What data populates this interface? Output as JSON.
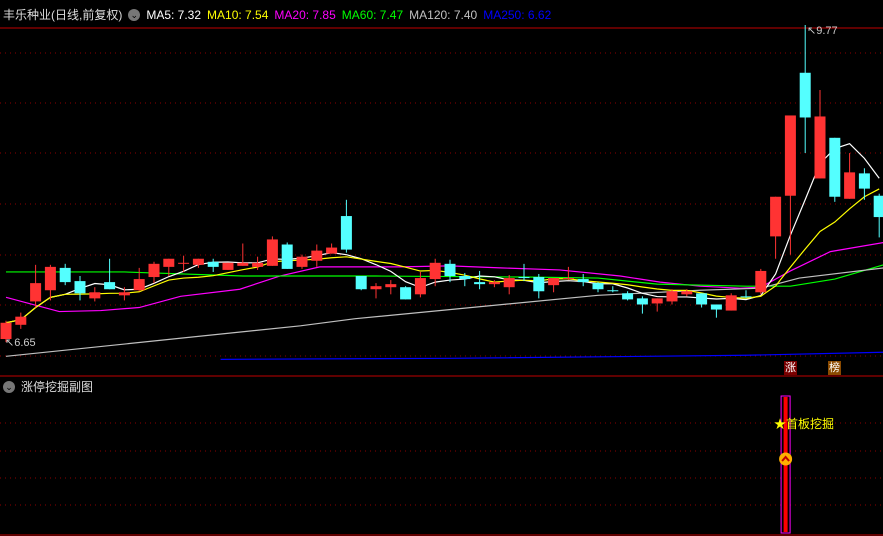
{
  "header": {
    "stock_title": "丰乐种业(日线,前复权)",
    "ma_values": [
      {
        "label": "MA5: 7.32",
        "color": "#ffffff"
      },
      {
        "label": "MA10: 7.54",
        "color": "#ffff00"
      },
      {
        "label": "MA20: 7.85",
        "color": "#ff00ff"
      },
      {
        "label": "MA60: 7.47",
        "color": "#00ff00"
      },
      {
        "label": "MA120: 7.40",
        "color": "#c0c0c0"
      },
      {
        "label": "MA250: 6.62",
        "color": "#0000ff"
      }
    ]
  },
  "sub_panel": {
    "title": "涨停挖掘副图",
    "signal_label": "首板挖掘",
    "tags": [
      "涨",
      "榜"
    ]
  },
  "colors": {
    "up": "#ff3333",
    "down": "#54ffff",
    "grid": "#8b0000",
    "border": "#c00000"
  },
  "chart_data": {
    "type": "candlestick",
    "title": "丰乐种业(日线,前复权)",
    "ylim": [
      6.65,
      9.77
    ],
    "annotations": {
      "high_label": "9.77",
      "low_label": "6.65"
    },
    "ohlc": [
      [
        6.68,
        6.86,
        6.65,
        6.84
      ],
      [
        6.82,
        6.94,
        6.78,
        6.9
      ],
      [
        7.05,
        7.41,
        6.99,
        7.23
      ],
      [
        7.16,
        7.41,
        7.06,
        7.39
      ],
      [
        7.38,
        7.42,
        7.21,
        7.24
      ],
      [
        7.25,
        7.3,
        7.06,
        7.13
      ],
      [
        7.08,
        7.19,
        7.05,
        7.14
      ],
      [
        7.24,
        7.47,
        7.17,
        7.17
      ],
      [
        7.11,
        7.19,
        7.06,
        7.14
      ],
      [
        7.16,
        7.38,
        7.15,
        7.27
      ],
      [
        7.29,
        7.44,
        7.23,
        7.42
      ],
      [
        7.39,
        7.47,
        7.3,
        7.47
      ],
      [
        7.43,
        7.5,
        7.34,
        7.43
      ],
      [
        7.41,
        7.47,
        7.38,
        7.47
      ],
      [
        7.44,
        7.47,
        7.34,
        7.39
      ],
      [
        7.36,
        7.43,
        7.36,
        7.43
      ],
      [
        7.4,
        7.62,
        7.4,
        7.43
      ],
      [
        7.39,
        7.49,
        7.36,
        7.43
      ],
      [
        7.4,
        7.69,
        7.4,
        7.66
      ],
      [
        7.61,
        7.63,
        7.37,
        7.37
      ],
      [
        7.39,
        7.51,
        7.37,
        7.49
      ],
      [
        7.45,
        7.61,
        7.39,
        7.55
      ],
      [
        7.52,
        7.62,
        7.52,
        7.58
      ],
      [
        7.89,
        8.05,
        7.53,
        7.56
      ],
      [
        7.3,
        7.3,
        7.16,
        7.17
      ],
      [
        7.17,
        7.23,
        7.08,
        7.2
      ],
      [
        7.19,
        7.26,
        7.12,
        7.22
      ],
      [
        7.19,
        7.2,
        7.07,
        7.07
      ],
      [
        7.12,
        7.34,
        7.09,
        7.28
      ],
      [
        7.27,
        7.47,
        7.2,
        7.43
      ],
      [
        7.42,
        7.46,
        7.24,
        7.3
      ],
      [
        7.3,
        7.33,
        7.2,
        7.27
      ],
      [
        7.24,
        7.35,
        7.17,
        7.22
      ],
      [
        7.22,
        7.26,
        7.19,
        7.24
      ],
      [
        7.19,
        7.31,
        7.12,
        7.28
      ],
      [
        7.29,
        7.42,
        7.25,
        7.28
      ],
      [
        7.29,
        7.32,
        7.08,
        7.15
      ],
      [
        7.21,
        7.28,
        7.14,
        7.28
      ],
      [
        7.28,
        7.39,
        7.26,
        7.28
      ],
      [
        7.27,
        7.32,
        7.2,
        7.24
      ],
      [
        7.23,
        7.24,
        7.14,
        7.17
      ],
      [
        7.16,
        7.2,
        7.14,
        7.15
      ],
      [
        7.13,
        7.15,
        7.06,
        7.07
      ],
      [
        7.08,
        7.1,
        6.93,
        7.02
      ],
      [
        7.03,
        7.08,
        6.95,
        7.08
      ],
      [
        7.05,
        7.17,
        7.02,
        7.15
      ],
      [
        7.12,
        7.17,
        7.1,
        7.15
      ],
      [
        7.13,
        7.13,
        6.99,
        7.02
      ],
      [
        7.02,
        7.02,
        6.89,
        6.97
      ],
      [
        6.96,
        7.13,
        6.96,
        7.11
      ],
      [
        7.1,
        7.16,
        7.08,
        7.09
      ],
      [
        7.14,
        7.37,
        7.12,
        7.35
      ],
      [
        7.69,
        8.08,
        7.47,
        8.08
      ],
      [
        8.09,
        8.88,
        7.51,
        8.88
      ],
      [
        9.3,
        9.77,
        8.51,
        8.86
      ],
      [
        8.26,
        9.13,
        8.26,
        8.87
      ],
      [
        8.66,
        8.66,
        8.03,
        8.08
      ],
      [
        8.06,
        8.51,
        8.06,
        8.32
      ],
      [
        8.31,
        8.36,
        8.05,
        8.16
      ],
      [
        8.09,
        8.11,
        7.68,
        7.88
      ]
    ],
    "ma_computed": [
      {
        "name": "MA5",
        "period": 5,
        "color": "#ffffff"
      },
      {
        "name": "MA10",
        "period": 10,
        "color": "#ffff00"
      }
    ],
    "ma_points": [
      {
        "name": "MA20",
        "color": "#ff00ff",
        "points": [
          [
            0,
            7.09
          ],
          [
            3.6,
            6.95
          ],
          [
            6.4,
            6.96
          ],
          [
            9,
            6.99
          ],
          [
            11.8,
            7.1
          ],
          [
            15.8,
            7.17
          ],
          [
            18.5,
            7.3
          ],
          [
            21.2,
            7.39
          ],
          [
            26.6,
            7.39
          ],
          [
            30,
            7.4
          ],
          [
            33.4,
            7.38
          ],
          [
            37.4,
            7.36
          ],
          [
            41.5,
            7.3
          ],
          [
            44.2,
            7.24
          ],
          [
            46.9,
            7.2
          ],
          [
            49.6,
            7.18
          ],
          [
            51,
            7.19
          ],
          [
            53,
            7.35
          ],
          [
            55.7,
            7.54
          ],
          [
            59.3,
            7.63
          ]
        ]
      },
      {
        "name": "MA60",
        "color": "#00ff00",
        "points": [
          [
            0,
            7.34
          ],
          [
            8,
            7.34
          ],
          [
            16,
            7.3
          ],
          [
            25,
            7.3
          ],
          [
            35,
            7.29
          ],
          [
            40,
            7.28
          ],
          [
            44,
            7.22
          ],
          [
            50,
            7.2
          ],
          [
            53,
            7.2
          ],
          [
            56,
            7.27
          ],
          [
            59.3,
            7.41
          ]
        ]
      },
      {
        "name": "MA120",
        "color": "#c0c0c0",
        "points": [
          [
            0,
            6.51
          ],
          [
            19.9,
            6.81
          ],
          [
            23.6,
            6.88
          ],
          [
            40,
            7.11
          ],
          [
            46.9,
            7.16
          ],
          [
            51,
            7.18
          ],
          [
            53.6,
            7.28
          ],
          [
            59.3,
            7.38
          ]
        ]
      },
      {
        "name": "MA250",
        "color": "#0000ff",
        "points": [
          [
            14.5,
            6.48
          ],
          [
            30,
            6.49
          ],
          [
            50,
            6.52
          ],
          [
            59.3,
            6.55
          ]
        ]
      }
    ],
    "sub_signal": {
      "index": 52,
      "label": "首板挖掘"
    }
  }
}
